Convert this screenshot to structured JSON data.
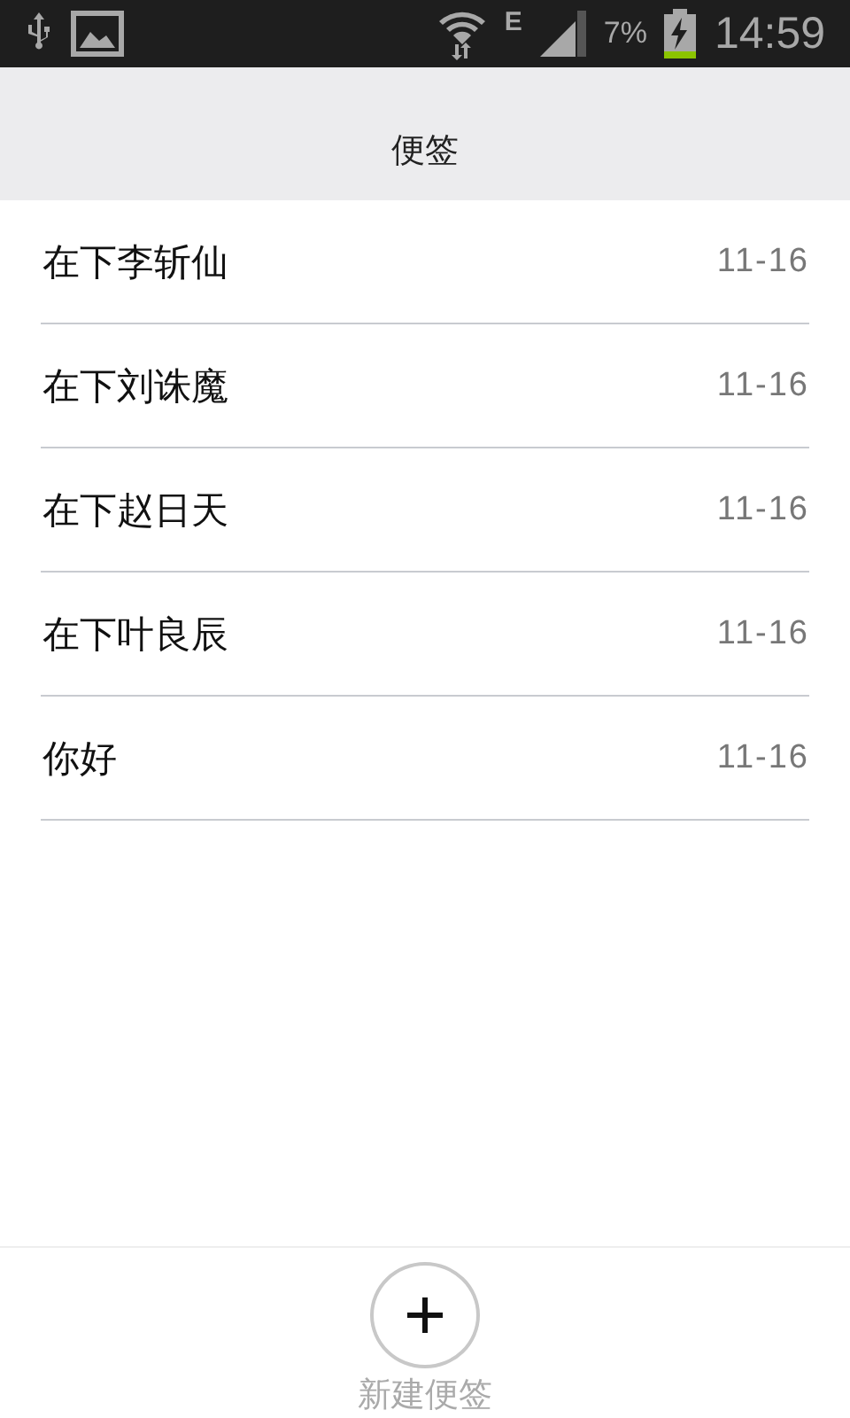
{
  "status_bar": {
    "network": "E",
    "battery": "7%",
    "time": "14:59"
  },
  "header": {
    "title": "便签"
  },
  "notes": [
    {
      "title": "在下李斩仙",
      "date": "11-16"
    },
    {
      "title": "在下刘诛魔",
      "date": "11-16"
    },
    {
      "title": "在下赵日天",
      "date": "11-16"
    },
    {
      "title": "在下叶良辰",
      "date": "11-16"
    },
    {
      "title": "你好",
      "date": "11-16"
    }
  ],
  "footer": {
    "button_label": "新建便签"
  }
}
